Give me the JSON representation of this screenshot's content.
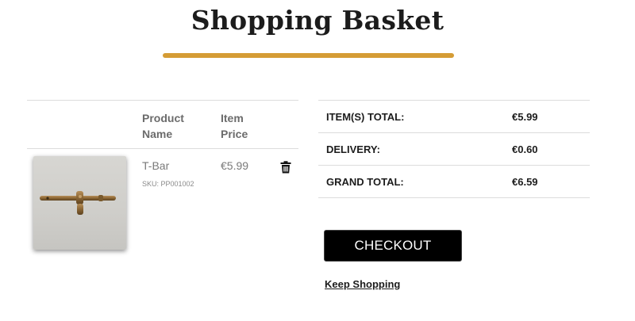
{
  "header": {
    "title": "Shopping Basket",
    "accent_color": "#d59c35"
  },
  "basket": {
    "columns": {
      "product_line1": "Product",
      "product_line2": "Name",
      "price_line1": "Item",
      "price_line2": "Price"
    },
    "items": [
      {
        "name": "T-Bar",
        "sku": "SKU: PP001002",
        "price": "€5.99",
        "image_icon": "t-bar-product-photo",
        "remove_icon": "trash-icon"
      }
    ]
  },
  "totals": {
    "rows": [
      {
        "label": "ITEM(S) TOTAL:",
        "value": "€5.99"
      },
      {
        "label": "DELIVERY:",
        "value": "€0.60"
      },
      {
        "label": "GRAND TOTAL:",
        "value": "€6.59"
      }
    ]
  },
  "actions": {
    "checkout_label": "CHECKOUT",
    "keep_shopping_label": "Keep Shopping"
  }
}
